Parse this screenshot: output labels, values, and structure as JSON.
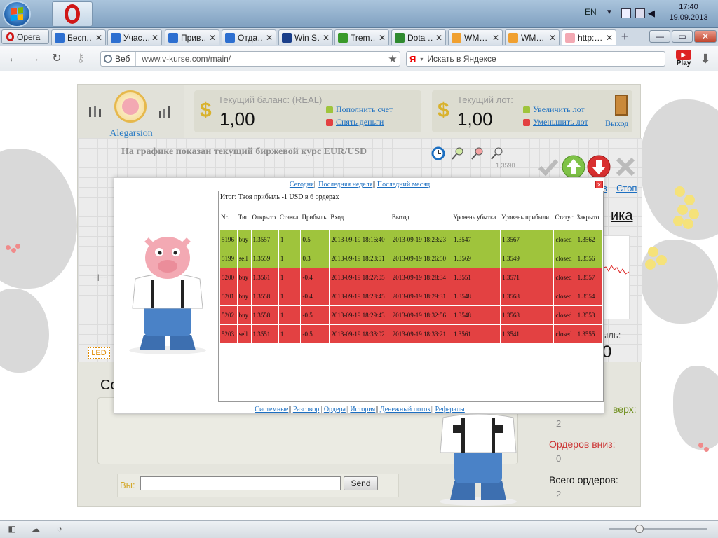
{
  "taskbar": {
    "language": "EN",
    "time": "17:40",
    "date": "19.09.2013"
  },
  "browser": {
    "menu_button": "Opera",
    "tabs": [
      {
        "label": "Бесп…",
        "fav_color": "#2d6fd0"
      },
      {
        "label": "Учас…",
        "fav_color": "#2d6fd0"
      },
      {
        "label": "Прив…",
        "fav_color": "#2d6fd0"
      },
      {
        "label": "Отда…",
        "fav_color": "#2d6fd0"
      },
      {
        "label": "Win S…",
        "fav_color": "#1b3f8a"
      },
      {
        "label": "Trem…",
        "fav_color": "#3a9a2a"
      },
      {
        "label": "Dota …",
        "fav_color": "#2f8a2f"
      },
      {
        "label": "WM…",
        "fav_color": "#f0a030"
      },
      {
        "label": "WM…",
        "fav_color": "#f0a030"
      },
      {
        "label": "http:…",
        "fav_color": "#f3a9b3"
      }
    ],
    "address_badge": "Веб",
    "url": "www.v-kurse.com/main/",
    "search_engine": "Я",
    "search_placeholder": "Искать в Яндексе",
    "play_label": "Play"
  },
  "app": {
    "username": "Alegarsion",
    "balance_label": "Текущий баланс: (REAL)",
    "currency_symbol": "$",
    "balance_value": "1,00",
    "deposit_link": "Пополнить счет",
    "withdraw_link": "Снять деньги",
    "lot_label": "Текущий лот:",
    "lot_value": "1,00",
    "increase_lot": "Увеличить лот",
    "decrease_lot": "Уменьшить лот",
    "exit_link": "Выход",
    "chart_title": "На графике показан текущий биржевой курс EUR/USD",
    "price_tick": "1,3590",
    "stop_link": "Стоп",
    "stop_partial": "в",
    "right_title": "ика",
    "profit_partial": "ыль:",
    "profit_value": "0",
    "orders_up_label": "верх:",
    "orders_up_value": "2",
    "orders_down_label": "Ордеров вниз:",
    "orders_down_value": "0",
    "orders_total_label": "Всего ордеров:",
    "orders_total_value": "2",
    "chat_label": "Со",
    "you_label": "Вы:",
    "send_button": "Send",
    "led_label": "LED",
    "crosshair": "−|−−"
  },
  "modal": {
    "period_links": [
      "Сегодня",
      "Последняя неделя",
      "Последний месяц"
    ],
    "summary": "Итог: Твоя прибыль -1 USD в 6 ордерах",
    "columns": [
      "Nr.",
      "Тип",
      "Открыто",
      "Ставка",
      "Прибыль",
      "Вход",
      "Выход",
      "Уровень убытка",
      "Уровень прибыли",
      "Статус",
      "Закрыто"
    ],
    "rows": [
      {
        "result": "win",
        "nr": "5196",
        "type": "buy",
        "open": "1.3557",
        "bet": "1",
        "profit": "0.5",
        "entry": "2013-09-19 18:16:40",
        "exit": "2013-09-19 18:23:23",
        "loss_level": "1.3547",
        "profit_level": "1.3567",
        "status": "closed",
        "closed": "1.3562"
      },
      {
        "result": "win",
        "nr": "5199",
        "type": "sell",
        "open": "1.3559",
        "bet": "1",
        "profit": "0.3",
        "entry": "2013-09-19 18:23:51",
        "exit": "2013-09-19 18:26:50",
        "loss_level": "1.3569",
        "profit_level": "1.3549",
        "status": "closed",
        "closed": "1.3556"
      },
      {
        "result": "loss",
        "nr": "5200",
        "type": "buy",
        "open": "1.3561",
        "bet": "1",
        "profit": "-0.4",
        "entry": "2013-09-19 18:27:05",
        "exit": "2013-09-19 18:28:34",
        "loss_level": "1.3551",
        "profit_level": "1.3571",
        "status": "closed",
        "closed": "1.3557"
      },
      {
        "result": "loss",
        "nr": "5201",
        "type": "buy",
        "open": "1.3558",
        "bet": "1",
        "profit": "-0.4",
        "entry": "2013-09-19 18:28:45",
        "exit": "2013-09-19 18:29:31",
        "loss_level": "1.3548",
        "profit_level": "1.3568",
        "status": "closed",
        "closed": "1.3554"
      },
      {
        "result": "loss",
        "nr": "5202",
        "type": "buy",
        "open": "1.3558",
        "bet": "1",
        "profit": "-0.5",
        "entry": "2013-09-19 18:29:43",
        "exit": "2013-09-19 18:32:56",
        "loss_level": "1.3548",
        "profit_level": "1.3568",
        "status": "closed",
        "closed": "1.3553"
      },
      {
        "result": "loss",
        "nr": "5203",
        "type": "sell",
        "open": "1.3551",
        "bet": "1",
        "profit": "-0.5",
        "entry": "2013-09-19 18:33:02",
        "exit": "2013-09-19 18:33:21",
        "loss_level": "1.3561",
        "profit_level": "1.3541",
        "status": "closed",
        "closed": "1.3555"
      }
    ],
    "bottom_links": [
      "Системные",
      "Разговор",
      "Ордера",
      "История",
      "Денежный поток",
      "Рефералы"
    ],
    "close_label": "x"
  },
  "colors": {
    "win_row": "#9fc43c",
    "loss_row": "#e34142",
    "link": "#1c6fc1",
    "accent_gold": "#d9b22d"
  },
  "icons": [
    "windows-start-icon",
    "opera-icon",
    "back-icon",
    "forward-icon",
    "reload-icon",
    "key-icon",
    "globe-icon",
    "star-icon",
    "download-icon",
    "door-icon",
    "clock-icon",
    "zoom-in-icon",
    "zoom-out-icon",
    "check-icon",
    "arrow-up-icon",
    "arrow-down-icon",
    "close-x-icon",
    "cloud-icon",
    "speed-icon"
  ]
}
